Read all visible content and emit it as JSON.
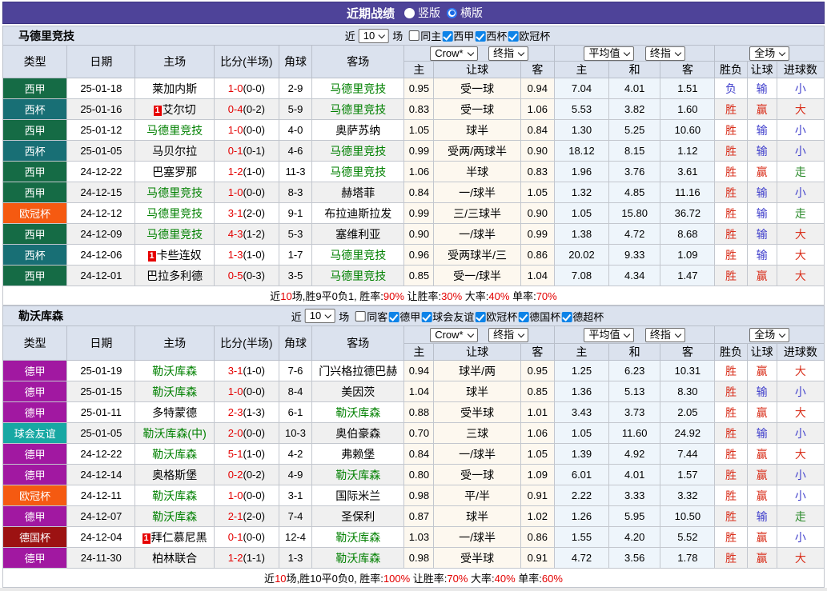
{
  "title_bar": {
    "title": "近期战绩",
    "layout_options": [
      {
        "label": "竖版",
        "selected": false
      },
      {
        "label": "横版",
        "selected": true
      }
    ]
  },
  "columns": {
    "type": "类型",
    "date": "日期",
    "home": "主场",
    "score": "比分(半场)",
    "corner": "角球",
    "away": "客场",
    "odds_home": "主",
    "odds_handicap": "让球",
    "odds_away": "客",
    "avg_home": "主",
    "avg_draw": "和",
    "avg_away": "客",
    "result_outcome": "胜负",
    "result_handicap": "让球",
    "result_goals": "进球数"
  },
  "colors": {
    "badges": {
      "西甲": "#156b45",
      "西杯": "#186f75",
      "欧冠杯": "#f55a11",
      "德甲": "#a118a1",
      "球会友谊": "#17a8a3",
      "德国杯": "#9c1212"
    },
    "result_map": {
      "胜": "red",
      "负": "blue",
      "赢": "red",
      "输": "blue",
      "大": "red",
      "小": "blue",
      "走": "green"
    },
    "team_highlight": "#008000",
    "score_red": "#e30000",
    "topbar": "#4e4399"
  },
  "sections": [
    {
      "team": "马德里竞技",
      "filter": {
        "recent_label": "近",
        "matches_value": "10",
        "matches_suffix": "场",
        "venue": {
          "label": "同主",
          "checked": false
        },
        "leagues": [
          {
            "label": "西甲",
            "checked": true
          },
          {
            "label": "西杯",
            "checked": true
          },
          {
            "label": "欧冠杯",
            "checked": true
          }
        ]
      },
      "selects": {
        "odds_source": "Crow*",
        "odds_time": "终指",
        "avg_source": "平均值",
        "avg_time": "终指",
        "scope": "全场"
      },
      "rows": [
        {
          "league": "西甲",
          "date": "25-01-18",
          "home": "莱加内斯",
          "home_hl": false,
          "home_rank": "",
          "ft": "1-0",
          "ht": "(0-0)",
          "corner": "2-9",
          "away": "马德里竞技",
          "away_hl": true,
          "away_rank": "",
          "crow": [
            "0.95",
            "受一球",
            "0.94"
          ],
          "avg": [
            "7.04",
            "4.01",
            "1.51"
          ],
          "res": [
            "负",
            "输",
            "小"
          ]
        },
        {
          "league": "西杯",
          "date": "25-01-16",
          "home": "艾尔切",
          "home_hl": false,
          "home_rank": "1",
          "ft": "0-4",
          "ht": "(0-2)",
          "corner": "5-9",
          "away": "马德里竞技",
          "away_hl": true,
          "away_rank": "",
          "crow": [
            "0.83",
            "受一球",
            "1.06"
          ],
          "avg": [
            "5.53",
            "3.82",
            "1.60"
          ],
          "res": [
            "胜",
            "赢",
            "大"
          ]
        },
        {
          "league": "西甲",
          "date": "25-01-12",
          "home": "马德里竞技",
          "home_hl": true,
          "home_rank": "",
          "ft": "1-0",
          "ht": "(0-0)",
          "corner": "4-0",
          "away": "奥萨苏纳",
          "away_hl": false,
          "away_rank": "",
          "crow": [
            "1.05",
            "球半",
            "0.84"
          ],
          "avg": [
            "1.30",
            "5.25",
            "10.60"
          ],
          "res": [
            "胜",
            "输",
            "小"
          ]
        },
        {
          "league": "西杯",
          "date": "25-01-05",
          "home": "马贝尔拉",
          "home_hl": false,
          "home_rank": "",
          "ft": "0-1",
          "ht": "(0-1)",
          "corner": "4-6",
          "away": "马德里竞技",
          "away_hl": true,
          "away_rank": "",
          "crow": [
            "0.99",
            "受两/两球半",
            "0.90"
          ],
          "avg": [
            "18.12",
            "8.15",
            "1.12"
          ],
          "res": [
            "胜",
            "输",
            "小"
          ]
        },
        {
          "league": "西甲",
          "date": "24-12-22",
          "home": "巴塞罗那",
          "home_hl": false,
          "home_rank": "",
          "ft": "1-2",
          "ht": "(1-0)",
          "corner": "11-3",
          "away": "马德里竞技",
          "away_hl": true,
          "away_rank": "",
          "crow": [
            "1.06",
            "半球",
            "0.83"
          ],
          "avg": [
            "1.96",
            "3.76",
            "3.61"
          ],
          "res": [
            "胜",
            "赢",
            "走"
          ]
        },
        {
          "league": "西甲",
          "date": "24-12-15",
          "home": "马德里竞技",
          "home_hl": true,
          "home_rank": "",
          "ft": "1-0",
          "ht": "(0-0)",
          "corner": "8-3",
          "away": "赫塔菲",
          "away_hl": false,
          "away_rank": "",
          "crow": [
            "0.84",
            "一/球半",
            "1.05"
          ],
          "avg": [
            "1.32",
            "4.85",
            "11.16"
          ],
          "res": [
            "胜",
            "输",
            "小"
          ]
        },
        {
          "league": "欧冠杯",
          "date": "24-12-12",
          "home": "马德里竞技",
          "home_hl": true,
          "home_rank": "",
          "ft": "3-1",
          "ht": "(2-0)",
          "corner": "9-1",
          "away": "布拉迪斯拉发",
          "away_hl": false,
          "away_rank": "",
          "crow": [
            "0.99",
            "三/三球半",
            "0.90"
          ],
          "avg": [
            "1.05",
            "15.80",
            "36.72"
          ],
          "res": [
            "胜",
            "输",
            "走"
          ]
        },
        {
          "league": "西甲",
          "date": "24-12-09",
          "home": "马德里竞技",
          "home_hl": true,
          "home_rank": "",
          "ft": "4-3",
          "ht": "(1-2)",
          "corner": "5-3",
          "away": "塞维利亚",
          "away_hl": false,
          "away_rank": "",
          "crow": [
            "0.90",
            "一/球半",
            "0.99"
          ],
          "avg": [
            "1.38",
            "4.72",
            "8.68"
          ],
          "res": [
            "胜",
            "输",
            "大"
          ]
        },
        {
          "league": "西杯",
          "date": "24-12-06",
          "home": "卡些连奴",
          "home_hl": false,
          "home_rank": "1",
          "ft": "1-3",
          "ht": "(1-0)",
          "corner": "1-7",
          "away": "马德里竞技",
          "away_hl": true,
          "away_rank": "",
          "crow": [
            "0.96",
            "受两球半/三",
            "0.86"
          ],
          "avg": [
            "20.02",
            "9.33",
            "1.09"
          ],
          "res": [
            "胜",
            "输",
            "大"
          ]
        },
        {
          "league": "西甲",
          "date": "24-12-01",
          "home": "巴拉多利德",
          "home_hl": false,
          "home_rank": "",
          "ft": "0-5",
          "ht": "(0-3)",
          "corner": "3-5",
          "away": "马德里竞技",
          "away_hl": true,
          "away_rank": "",
          "crow": [
            "0.85",
            "受一/球半",
            "1.04"
          ],
          "avg": [
            "7.08",
            "4.34",
            "1.47"
          ],
          "res": [
            "胜",
            "赢",
            "大"
          ]
        }
      ],
      "summary": {
        "segments": [
          {
            "t": "近",
            "r": false
          },
          {
            "t": "10",
            "r": true
          },
          {
            "t": "场,胜9平0负1, 胜率:",
            "r": false
          },
          {
            "t": "90%",
            "r": true
          },
          {
            "t": " 让胜率:",
            "r": false
          },
          {
            "t": "30%",
            "r": true
          },
          {
            "t": " 大率:",
            "r": false
          },
          {
            "t": "40%",
            "r": true
          },
          {
            "t": " 单率:",
            "r": false
          },
          {
            "t": "70%",
            "r": true
          }
        ]
      }
    },
    {
      "team": "勒沃库森",
      "filter": {
        "recent_label": "近",
        "matches_value": "10",
        "matches_suffix": "场",
        "venue": {
          "label": "同客",
          "checked": false
        },
        "leagues": [
          {
            "label": "德甲",
            "checked": true
          },
          {
            "label": "球会友谊",
            "checked": true
          },
          {
            "label": "欧冠杯",
            "checked": true
          },
          {
            "label": "德国杯",
            "checked": true
          },
          {
            "label": "德超杯",
            "checked": true
          }
        ]
      },
      "selects": {
        "odds_source": "Crow*",
        "odds_time": "终指",
        "avg_source": "平均值",
        "avg_time": "终指",
        "scope": "全场"
      },
      "rows": [
        {
          "league": "德甲",
          "date": "25-01-19",
          "home": "勒沃库森",
          "home_hl": true,
          "home_rank": "",
          "ft": "3-1",
          "ht": "(1-0)",
          "corner": "7-6",
          "away": "门兴格拉德巴赫",
          "away_hl": false,
          "away_rank": "",
          "crow": [
            "0.94",
            "球半/两",
            "0.95"
          ],
          "avg": [
            "1.25",
            "6.23",
            "10.31"
          ],
          "res": [
            "胜",
            "赢",
            "大"
          ]
        },
        {
          "league": "德甲",
          "date": "25-01-15",
          "home": "勒沃库森",
          "home_hl": true,
          "home_rank": "",
          "ft": "1-0",
          "ht": "(0-0)",
          "corner": "8-4",
          "away": "美因茨",
          "away_hl": false,
          "away_rank": "",
          "crow": [
            "1.04",
            "球半",
            "0.85"
          ],
          "avg": [
            "1.36",
            "5.13",
            "8.30"
          ],
          "res": [
            "胜",
            "输",
            "小"
          ]
        },
        {
          "league": "德甲",
          "date": "25-01-11",
          "home": "多特蒙德",
          "home_hl": false,
          "home_rank": "",
          "ft": "2-3",
          "ht": "(1-3)",
          "corner": "6-1",
          "away": "勒沃库森",
          "away_hl": true,
          "away_rank": "",
          "crow": [
            "0.88",
            "受半球",
            "1.01"
          ],
          "avg": [
            "3.43",
            "3.73",
            "2.05"
          ],
          "res": [
            "胜",
            "赢",
            "大"
          ]
        },
        {
          "league": "球会友谊",
          "date": "25-01-05",
          "home": "勒沃库森(中)",
          "home_hl": true,
          "home_rank": "",
          "ft": "2-0",
          "ht": "(0-0)",
          "corner": "10-3",
          "away": "奥伯豪森",
          "away_hl": false,
          "away_rank": "",
          "crow": [
            "0.70",
            "三球",
            "1.06"
          ],
          "avg": [
            "1.05",
            "11.60",
            "24.92"
          ],
          "res": [
            "胜",
            "输",
            "小"
          ]
        },
        {
          "league": "德甲",
          "date": "24-12-22",
          "home": "勒沃库森",
          "home_hl": true,
          "home_rank": "",
          "ft": "5-1",
          "ht": "(1-0)",
          "corner": "4-2",
          "away": "弗赖堡",
          "away_hl": false,
          "away_rank": "",
          "crow": [
            "0.84",
            "一/球半",
            "1.05"
          ],
          "avg": [
            "1.39",
            "4.92",
            "7.44"
          ],
          "res": [
            "胜",
            "赢",
            "大"
          ]
        },
        {
          "league": "德甲",
          "date": "24-12-14",
          "home": "奥格斯堡",
          "home_hl": false,
          "home_rank": "",
          "ft": "0-2",
          "ht": "(0-2)",
          "corner": "4-9",
          "away": "勒沃库森",
          "away_hl": true,
          "away_rank": "",
          "crow": [
            "0.80",
            "受一球",
            "1.09"
          ],
          "avg": [
            "6.01",
            "4.01",
            "1.57"
          ],
          "res": [
            "胜",
            "赢",
            "小"
          ]
        },
        {
          "league": "欧冠杯",
          "date": "24-12-11",
          "home": "勒沃库森",
          "home_hl": true,
          "home_rank": "",
          "ft": "1-0",
          "ht": "(0-0)",
          "corner": "3-1",
          "away": "国际米兰",
          "away_hl": false,
          "away_rank": "",
          "crow": [
            "0.98",
            "平/半",
            "0.91"
          ],
          "avg": [
            "2.22",
            "3.33",
            "3.32"
          ],
          "res": [
            "胜",
            "赢",
            "小"
          ]
        },
        {
          "league": "德甲",
          "date": "24-12-07",
          "home": "勒沃库森",
          "home_hl": true,
          "home_rank": "",
          "ft": "2-1",
          "ht": "(2-0)",
          "corner": "7-4",
          "away": "圣保利",
          "away_hl": false,
          "away_rank": "",
          "crow": [
            "0.87",
            "球半",
            "1.02"
          ],
          "avg": [
            "1.26",
            "5.95",
            "10.50"
          ],
          "res": [
            "胜",
            "输",
            "走"
          ]
        },
        {
          "league": "德国杯",
          "date": "24-12-04",
          "home": "拜仁慕尼黑",
          "home_hl": false,
          "home_rank": "1",
          "ft": "0-1",
          "ht": "(0-0)",
          "corner": "12-4",
          "away": "勒沃库森",
          "away_hl": true,
          "away_rank": "",
          "crow": [
            "1.03",
            "一/球半",
            "0.86"
          ],
          "avg": [
            "1.55",
            "4.20",
            "5.52"
          ],
          "res": [
            "胜",
            "赢",
            "小"
          ]
        },
        {
          "league": "德甲",
          "date": "24-11-30",
          "home": "柏林联合",
          "home_hl": false,
          "home_rank": "",
          "ft": "1-2",
          "ht": "(1-1)",
          "corner": "1-3",
          "away": "勒沃库森",
          "away_hl": true,
          "away_rank": "",
          "crow": [
            "0.98",
            "受半球",
            "0.91"
          ],
          "avg": [
            "4.72",
            "3.56",
            "1.78"
          ],
          "res": [
            "胜",
            "赢",
            "大"
          ]
        }
      ],
      "summary": {
        "segments": [
          {
            "t": "近",
            "r": false
          },
          {
            "t": "10",
            "r": true
          },
          {
            "t": "场,胜10平0负0, 胜率:",
            "r": false
          },
          {
            "t": "100%",
            "r": true
          },
          {
            "t": " 让胜率:",
            "r": false
          },
          {
            "t": "70%",
            "r": true
          },
          {
            "t": " 大率:",
            "r": false
          },
          {
            "t": "40%",
            "r": true
          },
          {
            "t": " 单率:",
            "r": false
          },
          {
            "t": "60%",
            "r": true
          }
        ]
      }
    }
  ]
}
